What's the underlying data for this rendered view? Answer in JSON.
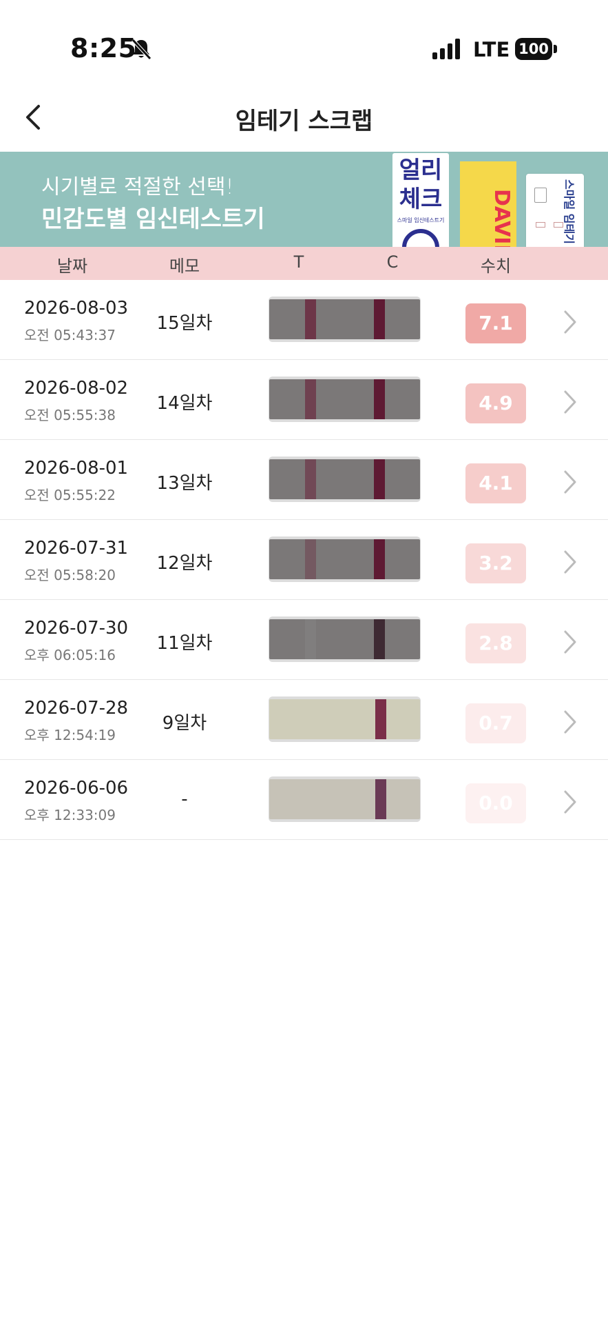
{
  "status_bar": {
    "time": "8:25",
    "network": "LTE",
    "battery": "100"
  },
  "nav": {
    "title": "임테기 스크랩"
  },
  "banner": {
    "line1": "시기별로 적절한 선택!",
    "line2": "민감도별 임신테스트기",
    "products": {
      "early_check": {
        "title_line1": "얼리",
        "title_line2": "체크",
        "sub": "스마일 임신테스트기"
      },
      "david": {
        "text": "DAVID -SUPER"
      },
      "smile": {
        "text": "스마일 임테기"
      }
    }
  },
  "table": {
    "headers": {
      "date": "날짜",
      "memo": "메모",
      "t": "T",
      "c": "C",
      "value": "수치"
    },
    "rows": [
      {
        "date": "2026-08-03",
        "time": "오전 05:43:37",
        "memo": "15일차",
        "value": "7.1",
        "badge_color": "#f0a9a6",
        "strip": "gray",
        "t_line_color": "#6b2a3f",
        "t_opacity": 0.85,
        "c_line_color": "#5e1a33"
      },
      {
        "date": "2026-08-02",
        "time": "오전 05:55:38",
        "memo": "14일차",
        "value": "4.9",
        "badge_color": "#f4c3c1",
        "strip": "gray",
        "t_line_color": "#6b2a3f",
        "t_opacity": 0.7,
        "c_line_color": "#5e1a33"
      },
      {
        "date": "2026-08-01",
        "time": "오전 05:55:22",
        "memo": "13일차",
        "value": "4.1",
        "badge_color": "#f6cdcb",
        "strip": "gray",
        "t_line_color": "#6b2a3f",
        "t_opacity": 0.6,
        "c_line_color": "#5e1a33"
      },
      {
        "date": "2026-07-31",
        "time": "오전 05:58:20",
        "memo": "12일차",
        "value": "3.2",
        "badge_color": "#f8d9d8",
        "strip": "gray",
        "t_line_color": "#6b2a3f",
        "t_opacity": 0.4,
        "c_line_color": "#5e1a33"
      },
      {
        "date": "2026-07-30",
        "time": "오후 06:05:16",
        "memo": "11일차",
        "value": "2.8",
        "badge_color": "#fae2e1",
        "strip": "gray",
        "t_line_color": "#8a8686",
        "t_opacity": 0.4,
        "c_line_color": "#3e2a33"
      },
      {
        "date": "2026-07-28",
        "time": "오후 12:54:19",
        "memo": "9일차",
        "value": "0.7",
        "badge_color": "#fcecec",
        "strip": "light",
        "t_line_color": "#cfcdb9",
        "t_opacity": 0.0,
        "c_line_color": "#7a2e48"
      },
      {
        "date": "2026-06-06",
        "time": "오후 12:33:09",
        "memo": "-",
        "value": "0.0",
        "badge_color": "#fdf1f1",
        "strip": "light2",
        "t_line_color": "#c6c2b7",
        "t_opacity": 0.0,
        "c_line_color": "#6a3a55"
      }
    ]
  },
  "icons": {
    "back": "chevron-left-icon",
    "bell": "bell-slash-icon",
    "signal": "cellular-signal-icon",
    "battery": "battery-icon",
    "row_chevron": "chevron-right-icon"
  }
}
